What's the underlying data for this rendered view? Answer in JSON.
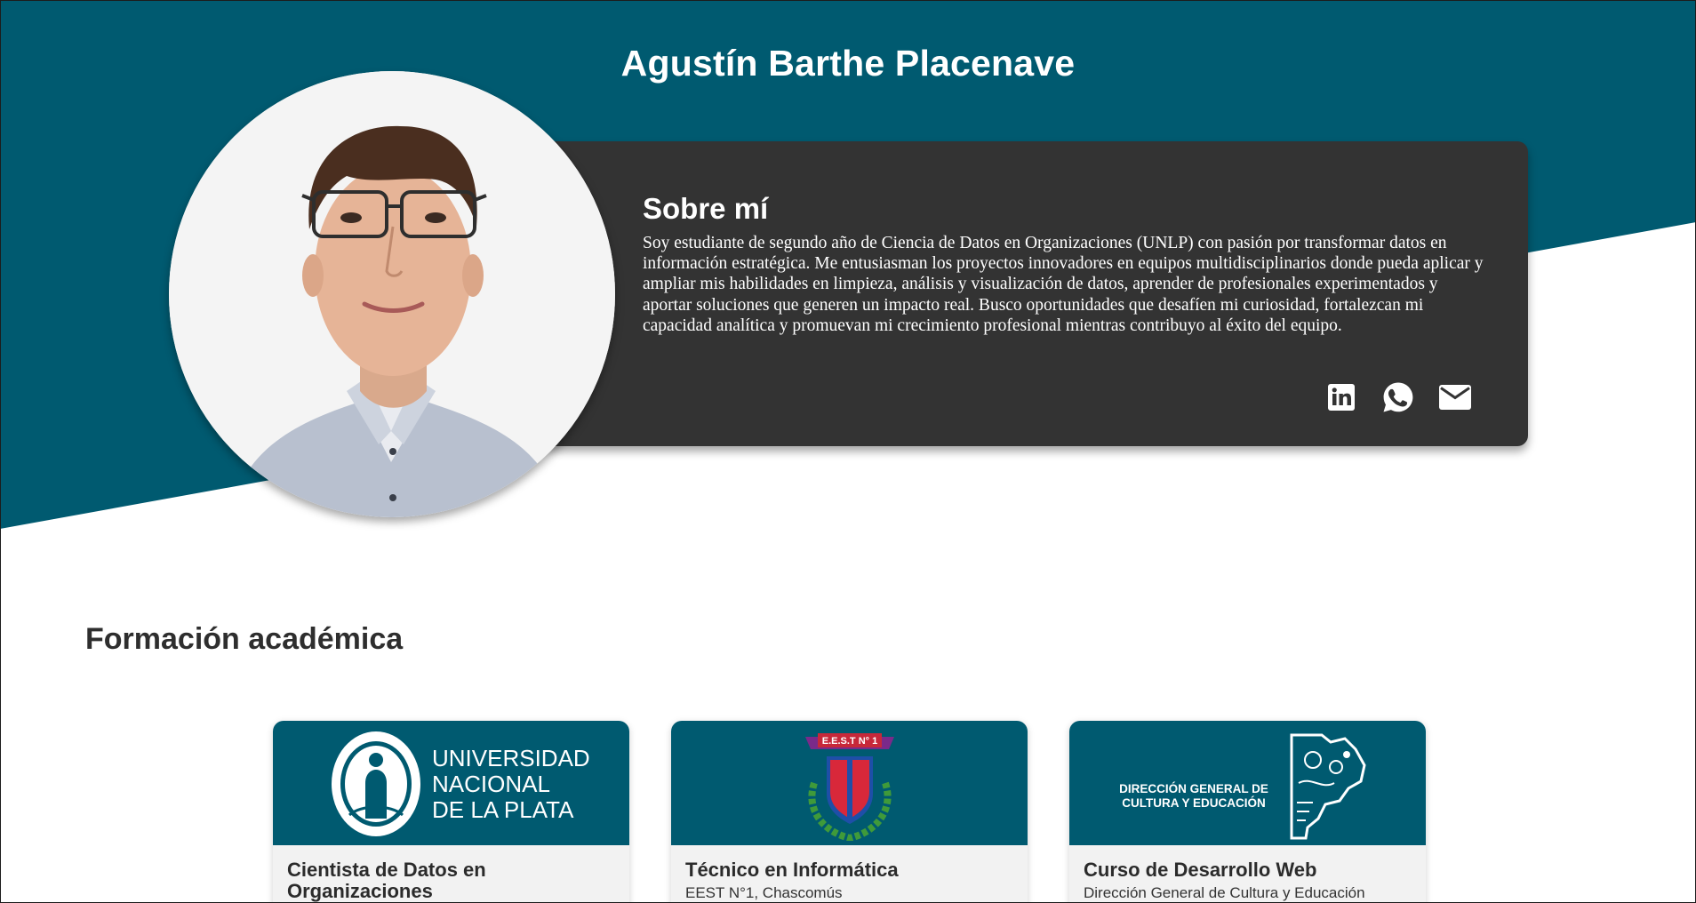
{
  "profile": {
    "name": "Agustín Barthe Placenave"
  },
  "about": {
    "title": "Sobre mí",
    "text": "Soy estudiante de segundo año de Ciencia de Datos en Organizaciones (UNLP) con pasión por transformar datos en información estratégica. Me entusiasman los proyectos innovadores en equipos multidisciplinarios donde pueda aplicar y ampliar mis habilidades en limpieza, análisis y visualización de datos, aprender de profesionales experimentados y aportar soluciones que generen un impacto real. Busco oportunidades que desafíen mi curiosidad, fortalezcan mi capacidad analítica y promuevan mi crecimiento profesional mientras contribuyo al éxito del equipo.",
    "socials": [
      {
        "icon": "linkedin-icon"
      },
      {
        "icon": "whatsapp-icon"
      },
      {
        "icon": "mail-icon"
      }
    ]
  },
  "education": {
    "title": "Formación académica",
    "cards": [
      {
        "logo": "unlp-logo",
        "logo_text": [
          "UNIVERSIDAD",
          "NACIONAL",
          "DE LA PLATA"
        ],
        "title": "Cientista de Datos en Organizaciones",
        "subtitle": ""
      },
      {
        "logo": "eest-crest-logo",
        "banner_text": "E.E.S.T N° 1",
        "title": "Técnico en Informática",
        "subtitle": "EEST N°1, Chascomús"
      },
      {
        "logo": "dgce-logo",
        "logo_text": [
          "DIRECCIÓN GENERAL DE",
          "CULTURA Y EDUCACIÓN"
        ],
        "title": "Curso de Desarrollo Web",
        "subtitle": "Dirección General de Cultura y Educación"
      }
    ]
  },
  "colors": {
    "brand_teal": "#005a70",
    "card_dark": "#333333",
    "card_light": "#f2f2f2"
  }
}
